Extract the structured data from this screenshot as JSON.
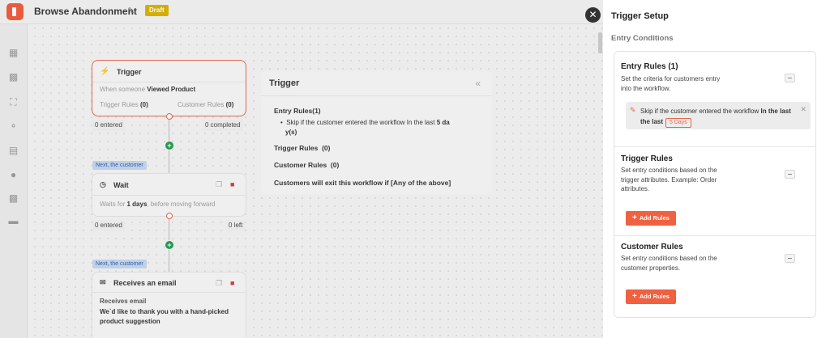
{
  "header": {
    "title": "Browse Abandonment",
    "status": "Draft"
  },
  "canvas": {
    "trigger_card": {
      "title": "Trigger",
      "desc_prefix": "When someone",
      "desc_event": "Viewed Product",
      "trigger_rules_label": "Trigger Rules",
      "trigger_rules_count": "(0)",
      "customer_rules_label": "Customer Rules",
      "customer_rules_count": "(0)",
      "entered": "0 entered",
      "completed": "0 completed"
    },
    "next_tag_1": "Next, the customer",
    "wait_card": {
      "title": "Wait",
      "desc_prefix": "Waits for",
      "desc_value": "1 days",
      "desc_suffix": ", before moving forward",
      "entered": "0 entered",
      "left": "0 left"
    },
    "next_tag_2": "Next, the customer",
    "email_card": {
      "title": "Receives an email",
      "subtitle": "Receives email",
      "line1": "We`d like to thank you with a hand-picked",
      "line2": "product suggestion"
    }
  },
  "summary_panel": {
    "title": "Trigger",
    "entry_rules": "Entry Rules(1)",
    "entry_rule_line1": "Skip if the customer entered the workflow In the last",
    "entry_rule_value1": "5 da",
    "entry_rule_value2": "y(s)",
    "trigger_rules_label": "Trigger Rules",
    "trigger_rules_count": "(0)",
    "customer_rules_label": "Customer Rules",
    "customer_rules_count": "(0)",
    "exit_text": "Customers will exit this workflow if [Any of the above]"
  },
  "drawer": {
    "title": "Trigger Setup",
    "subtitle": "Entry Conditions",
    "entry_rules": {
      "title": "Entry Rules (1)",
      "desc": "Set the criteria for customers entry into the workflow.",
      "rule_text": "Skip if the customer entered the workflow",
      "rule_text_bold": "In the last",
      "rule_days": "5 Days"
    },
    "trigger_rules": {
      "title": "Trigger Rules",
      "desc": "Set entry conditions based on the trigger attributes. Example: Order attributes.",
      "button": "Add Rules"
    },
    "customer_rules": {
      "title": "Customer Rules",
      "desc": "Set entry conditions based on the customer properties.",
      "button": "Add Rules"
    }
  },
  "colors": {
    "accent": "#ef6141",
    "draft": "#d9b200",
    "plus": "#1f9b4e",
    "tag": "#c5d6f0"
  }
}
